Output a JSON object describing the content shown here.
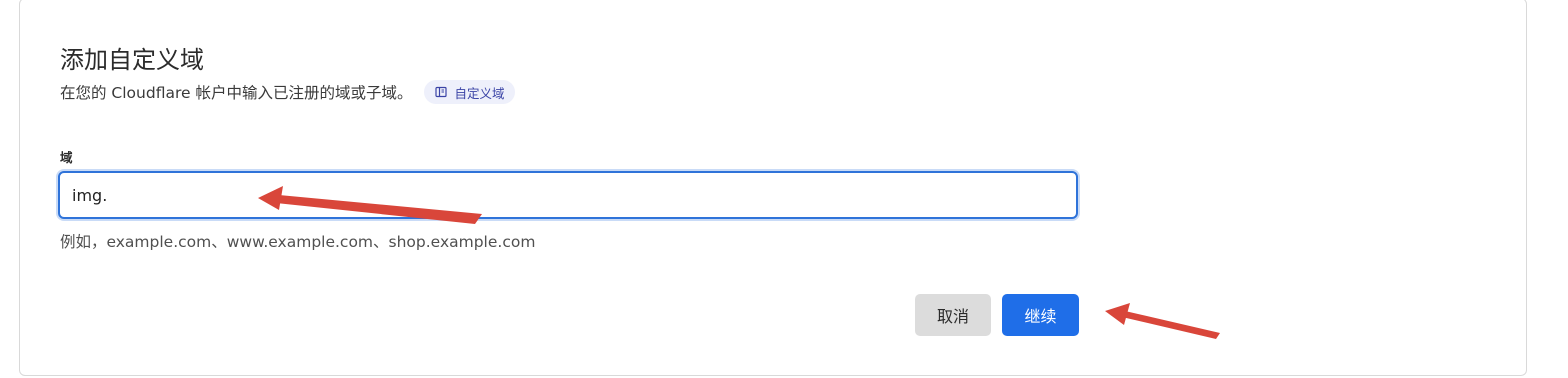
{
  "dialog": {
    "title": "添加自定义域",
    "subtitle": "在您的 Cloudflare 帐户中输入已注册的域或子域。",
    "doc_link": {
      "label": "自定义域",
      "icon": "book-icon"
    }
  },
  "domain_field": {
    "label": "域",
    "value": "img.",
    "helper": "例如，example.com、www.example.com、shop.example.com"
  },
  "actions": {
    "cancel_label": "取消",
    "continue_label": "继续"
  },
  "annotations": {
    "arrow_color": "#d9463a"
  },
  "colors": {
    "accent": "#1f6ee8",
    "input_focus": "#2f73d9",
    "badge_bg": "#eef0fb",
    "badge_text": "#3a43a6"
  }
}
